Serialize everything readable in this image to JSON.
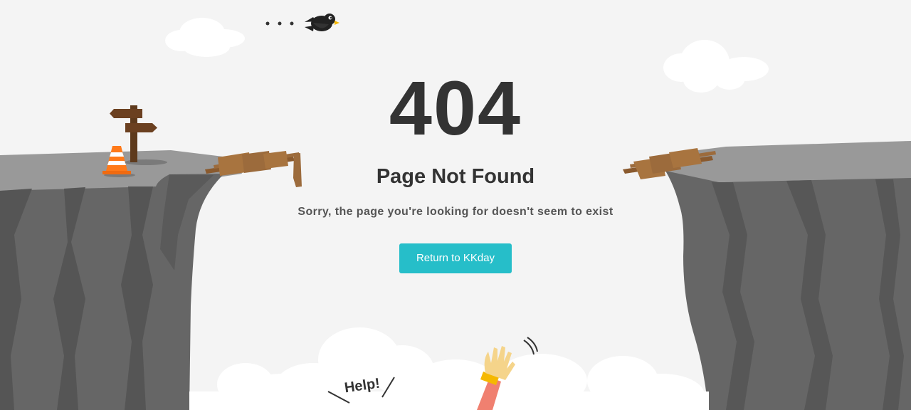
{
  "error": {
    "code": "404",
    "title": "Page Not Found",
    "description": "Sorry, the page you're looking for doesn't seem to exist"
  },
  "actions": {
    "return_label": "Return to KKday"
  },
  "illustration": {
    "help_text": "Help!",
    "icons": [
      "bird-icon",
      "signpost-icon",
      "traffic-cone-icon",
      "broken-bridge-icon",
      "waving-hand-icon",
      "cloud-icon"
    ]
  },
  "colors": {
    "background": "#f4f4f4",
    "cliff_top": "#999999",
    "cliff_face": "#666666",
    "cliff_shade": "#555555",
    "accent_button": "#26bec9",
    "text_primary": "#333333",
    "text_secondary": "#555555",
    "plank": "#9c6b3c",
    "cone": "#ff7a1a",
    "hand": "#f5d48a",
    "sleeve": "#f08070"
  }
}
